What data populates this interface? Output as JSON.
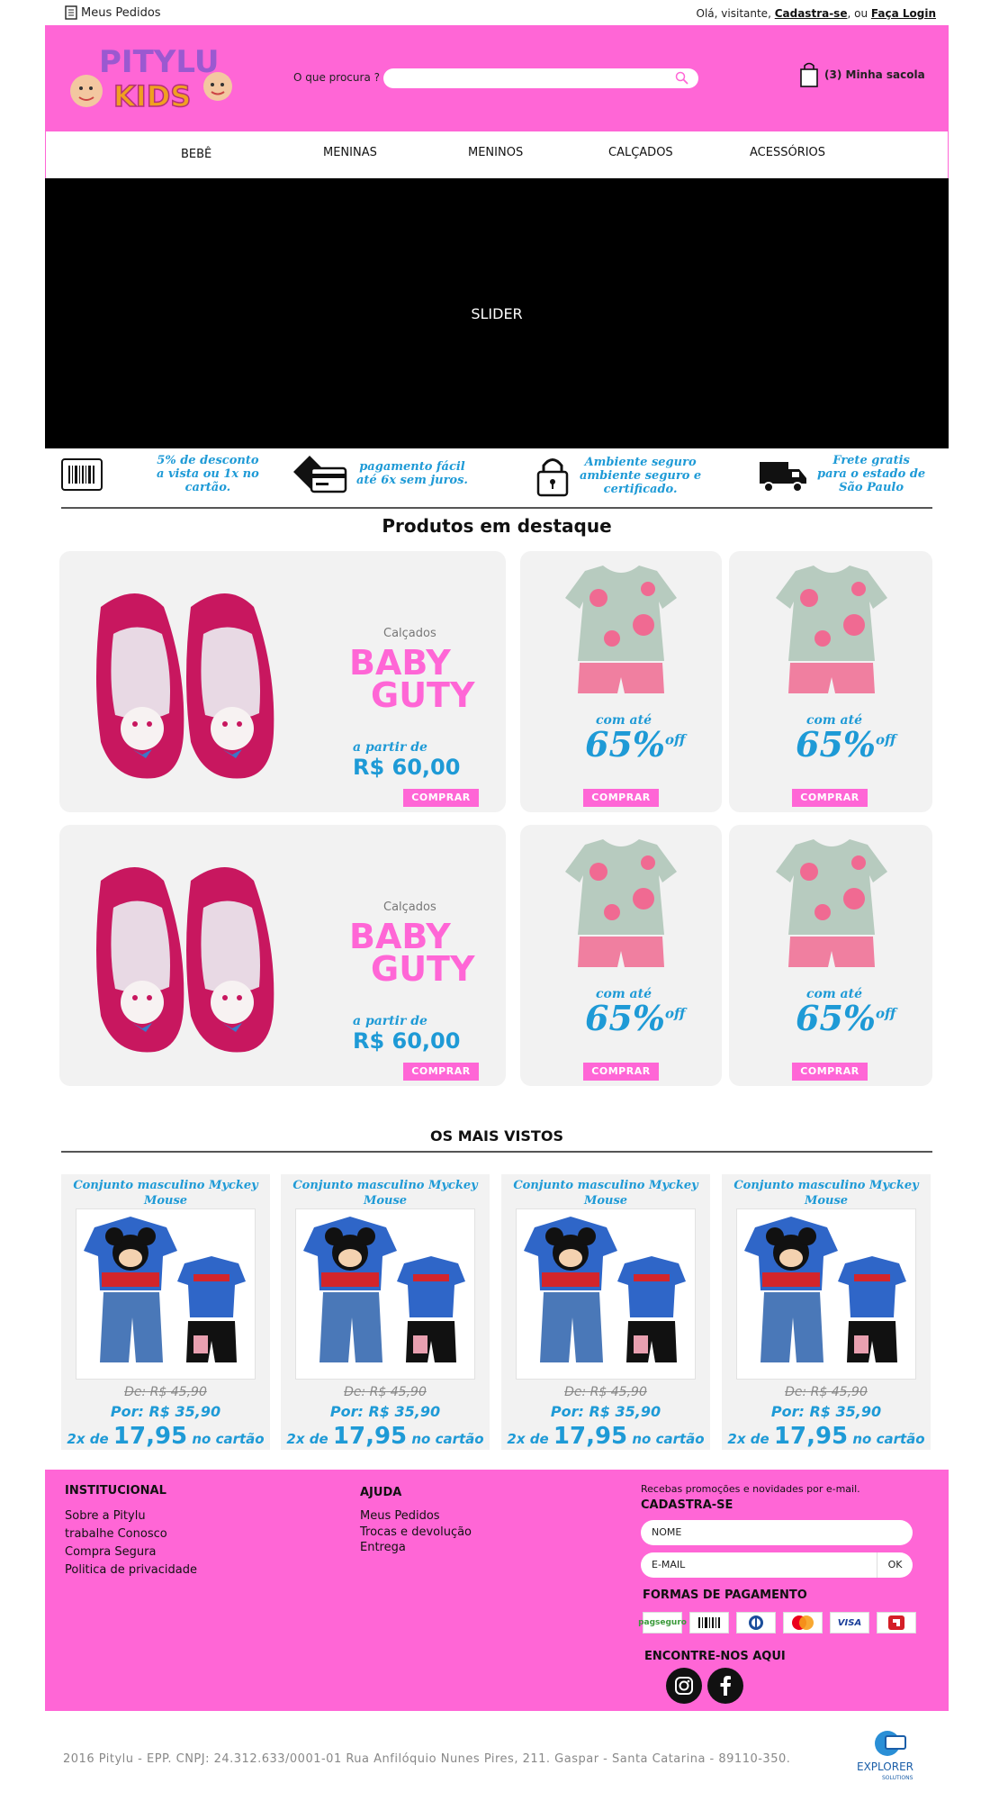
{
  "topbar": {
    "orders": "Meus Pedidos",
    "greeting": "Olá, visitante,",
    "signup": "Cadastra-se",
    "or": ", ou",
    "login": "Faça Login"
  },
  "header": {
    "logo_text_top": "PITYLU",
    "logo_text_bottom": "KIDS",
    "search_label": "O que procura ?",
    "search_placeholder": "",
    "bag_label": "(3) Minha sacola"
  },
  "nav": [
    "BEBÊ",
    "MENINAS",
    "MENINOS",
    "CALÇADOS",
    "ACESSÓRIOS"
  ],
  "slider": {
    "label": "SLIDER"
  },
  "features": [
    {
      "icon": "barcode-icon",
      "lines": [
        "5% de desconto",
        "a vista ou 1x no",
        "cartão."
      ]
    },
    {
      "icon": "credit-card-icon",
      "lines": [
        "pagamento fácil",
        "até 6x sem juros."
      ]
    },
    {
      "icon": "lock-icon",
      "lines": [
        "Ambiente seguro",
        "ambiente seguro e",
        "certificado."
      ]
    },
    {
      "icon": "truck-icon",
      "lines": [
        "Frete gratis",
        "para o estado de",
        "São Paulo"
      ]
    }
  ],
  "featured": {
    "title": "Produtos em destaque",
    "big": {
      "category": "Calçados",
      "brand_line1": "BABY",
      "brand_line2": "GUTY",
      "from": "a partir de",
      "price": "R$ 60,00",
      "button": "COMPRAR"
    },
    "small": {
      "prefix": "com até",
      "percent": "65%",
      "off": "off",
      "button": "COMPRAR"
    }
  },
  "most_viewed": {
    "title": "OS MAIS VISTOS",
    "items": [
      {
        "name": "Conjunto masculino Myckey Mouse",
        "old_price": "De: R$ 45,90",
        "price": "Por: R$ 35,90",
        "inst_prefix": "2x de",
        "inst_value": "17,95",
        "inst_suffix": "no cartão"
      },
      {
        "name": "Conjunto masculino Myckey Mouse",
        "old_price": "De: R$ 45,90",
        "price": "Por: R$ 35,90",
        "inst_prefix": "2x de",
        "inst_value": "17,95",
        "inst_suffix": "no cartão"
      },
      {
        "name": "Conjunto masculino Myckey Mouse",
        "old_price": "De: R$ 45,90",
        "price": "Por: R$ 35,90",
        "inst_prefix": "2x de",
        "inst_value": "17,95",
        "inst_suffix": "no cartão"
      },
      {
        "name": "Conjunto masculino Myckey Mouse",
        "old_price": "De: R$ 45,90",
        "price": "Por: R$ 35,90",
        "inst_prefix": "2x de",
        "inst_value": "17,95",
        "inst_suffix": "no cartão"
      }
    ]
  },
  "footer": {
    "institutional_title": "INSTITUCIONAL",
    "institutional": [
      "Sobre a Pitylu",
      "trabalhe Conosco",
      "Compra Segura",
      "Politica de privacidade"
    ],
    "help_title": "AJUDA",
    "help": [
      "Meus Pedidos",
      "Trocas e devolução",
      "Entrega"
    ],
    "newsletter_note": "Recebas promoções e novidades por e-mail.",
    "signup_title": "CADASTRA-SE",
    "name_placeholder": "NOME",
    "email_placeholder": "E-MAIL",
    "ok": "OK",
    "payment_title": "FORMAS DE PAGAMENTO",
    "payments": [
      "pagseguro",
      "boleto",
      "diners",
      "mastercard",
      "VISA",
      "hipercard"
    ],
    "social_title": "ENCONTRE-NOS AQUI",
    "social": [
      "instagram-icon",
      "facebook-icon"
    ]
  },
  "copyright": "2016 Pitylu - EPP. CNPJ: 24.312.633/0001-01 Rua Anfilóquio Nunes Pires, 211. Gaspar - Santa Catarina - 89110-350.",
  "credit": {
    "brand": "EXPLORER",
    "sub": "SOLUTIONS"
  },
  "colors": {
    "pink": "#ff66d6",
    "blue": "#1e9ad6",
    "card": "#f2f2f2"
  }
}
